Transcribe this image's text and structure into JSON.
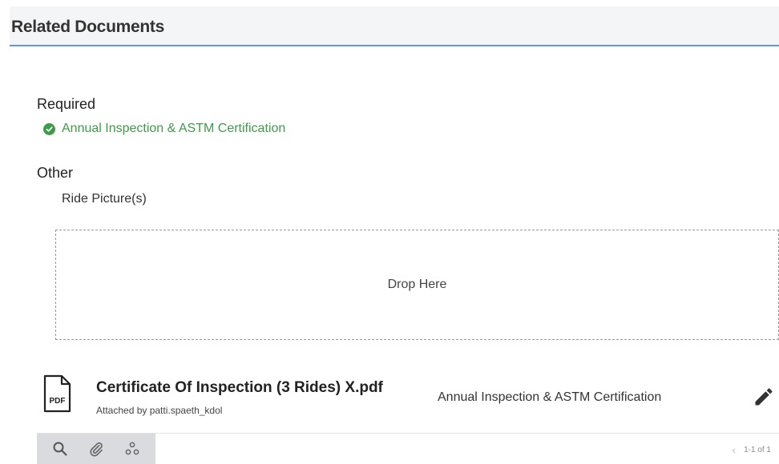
{
  "header": {
    "title": "Related Documents"
  },
  "required": {
    "label": "Required",
    "items": [
      {
        "label": "Annual Inspection & ASTM Certification",
        "status": "complete"
      }
    ]
  },
  "other": {
    "label": "Other",
    "items": [
      {
        "label": "Ride Picture(s)"
      }
    ]
  },
  "dropzone": {
    "label": "Drop Here"
  },
  "attachment": {
    "icon_label": "PDF",
    "file_name": "Certificate Of Inspection (3 Rides) X.pdf",
    "attached_by": "Attached by patti.spaeth_kdol",
    "category": "Annual Inspection & ASTM Certification"
  },
  "footer": {
    "pager_text": "1-1 of 1",
    "prev_glyph": "‹"
  },
  "colors": {
    "accent_line": "#5b9bd5",
    "success_green": "#3f9a4a",
    "header_bg": "#f4f5f6",
    "toolbar_bg": "#d9dbde"
  }
}
